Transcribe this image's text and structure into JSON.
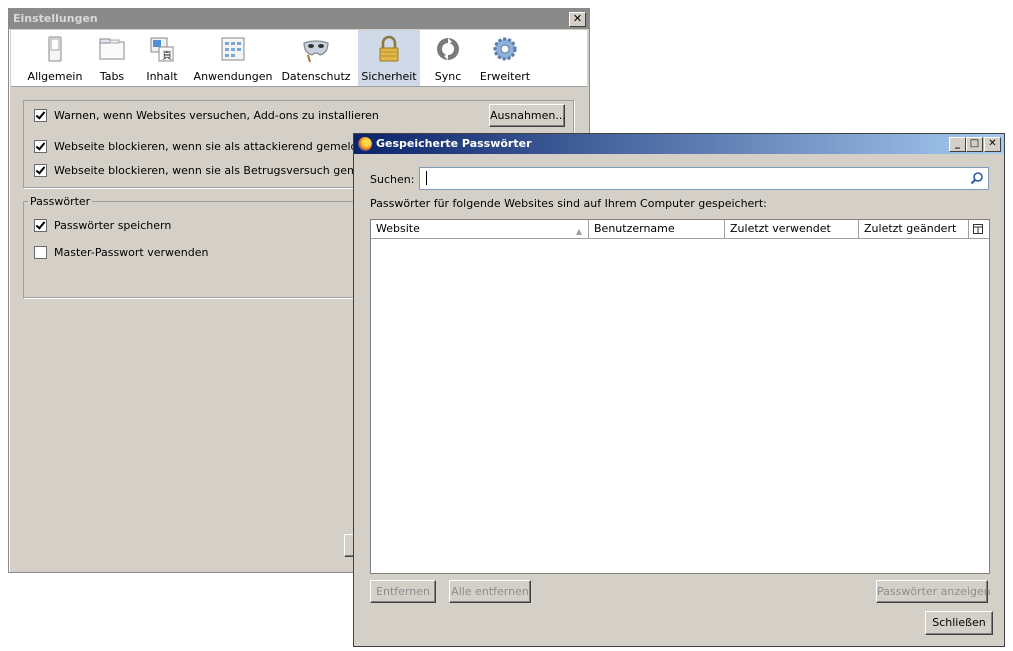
{
  "settings": {
    "title": "Einstellungen",
    "close": "✕",
    "toolbar": [
      {
        "label": "Allgemein",
        "icon": "switch-icon"
      },
      {
        "label": "Tabs",
        "icon": "tabs-icon"
      },
      {
        "label": "Inhalt",
        "icon": "content-icon"
      },
      {
        "label": "Anwendungen",
        "icon": "applications-icon"
      },
      {
        "label": "Datenschutz",
        "icon": "mask-icon"
      },
      {
        "label": "Sicherheit",
        "icon": "padlock-icon"
      },
      {
        "label": "Sync",
        "icon": "sync-icon"
      },
      {
        "label": "Erweitert",
        "icon": "gear-icon"
      }
    ],
    "active_tab": "Sicherheit",
    "general": {
      "addons_warn": "Warnen, wenn Websites versuchen, Add-ons zu installieren",
      "exceptions_button": "Ausnahmen...",
      "block_attack": "Webseite blockieren, wenn sie als attackierend gemeldet wurde",
      "block_forgery": "Webseite blockieren, wenn sie als Betrugsversuch gemeldet wurde"
    },
    "passwords": {
      "legend": "Passwörter",
      "save_passwords": "Passwörter speichern",
      "master_password": "Master-Passwort verwenden"
    }
  },
  "pwd": {
    "title": "Gespeicherte Passwörter",
    "minimize": "_",
    "maximize": "□",
    "close": "✕",
    "search_label": "Suchen:",
    "search_value": "",
    "info": "Passwörter für folgende Websites sind auf Ihrem Computer gespeichert:",
    "columns": [
      "Website",
      "Benutzername",
      "Zuletzt verwendet",
      "Zuletzt geändert"
    ],
    "buttons": {
      "remove": "Entfernen",
      "remove_all": "Alle entfernen",
      "show_passwords": "Passwörter anzeigen",
      "close": "Schließen"
    }
  }
}
